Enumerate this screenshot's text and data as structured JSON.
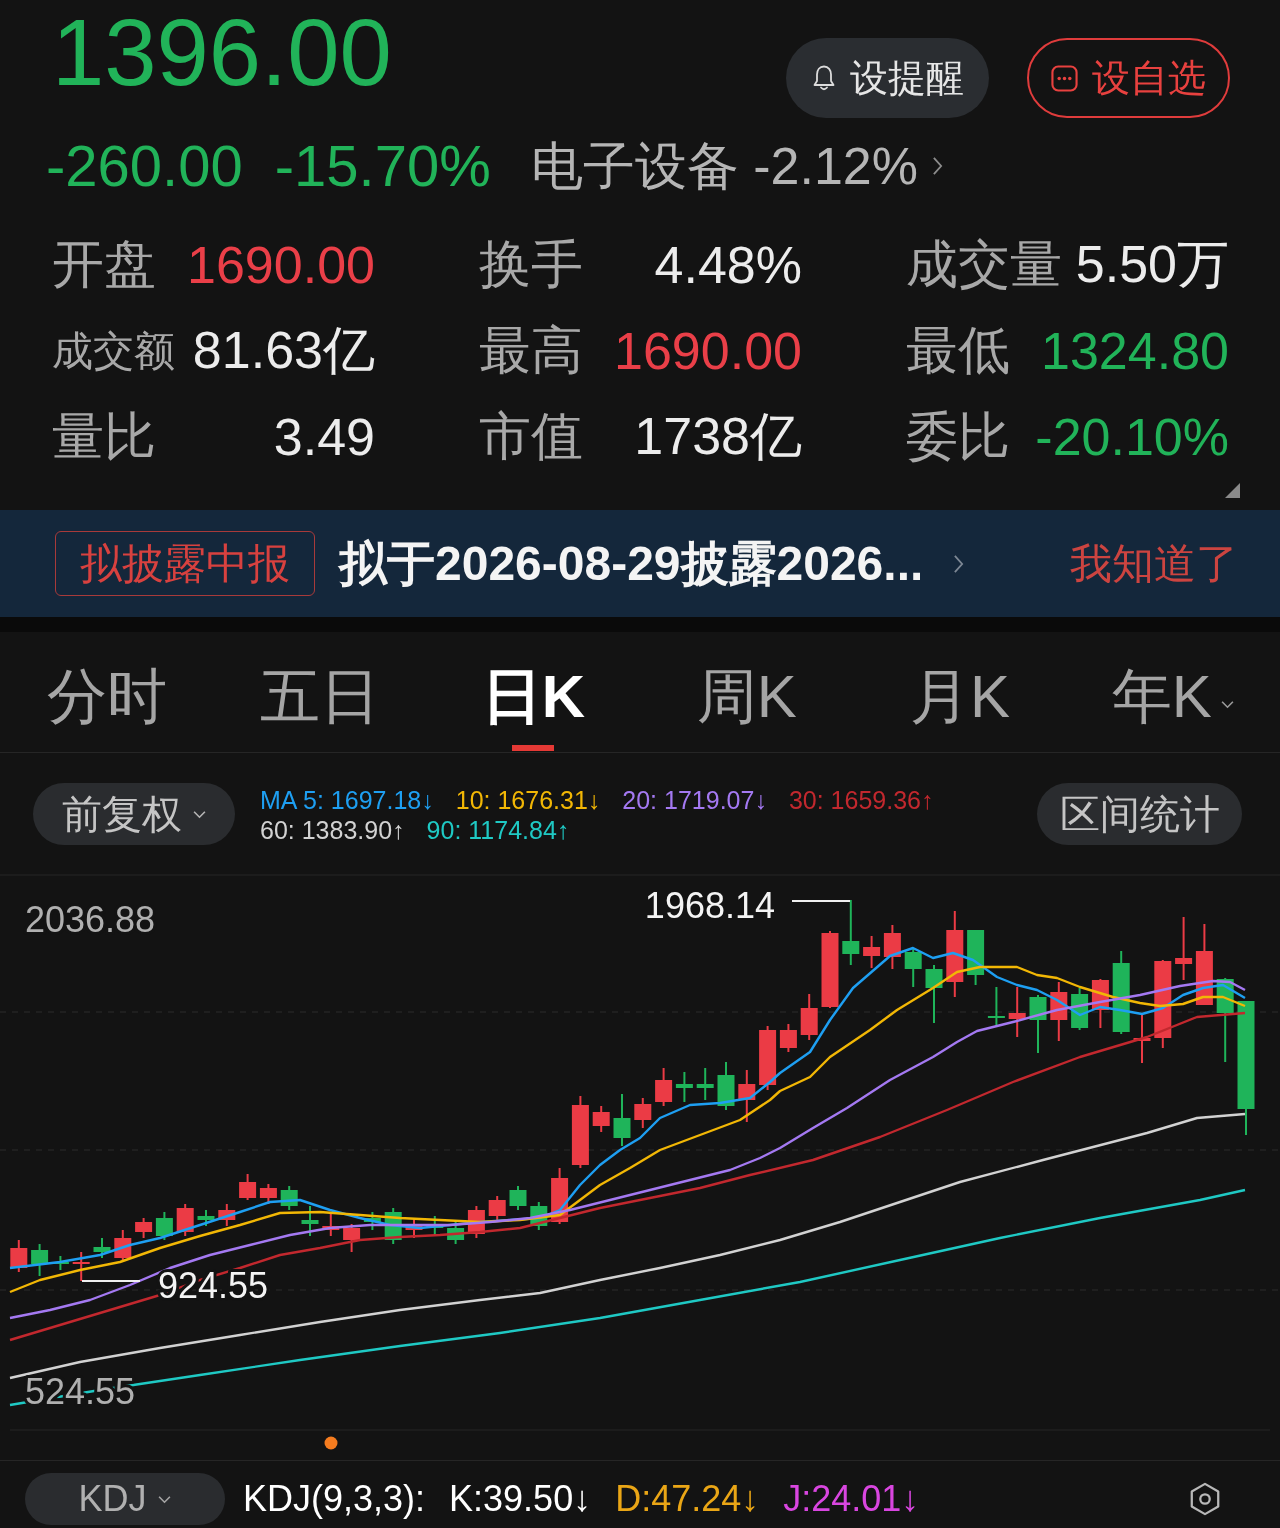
{
  "quote": {
    "price": "1396.00",
    "change": "-260.00",
    "change_percent": "-15.70%",
    "falling": true,
    "sector_link": "电子设备 -2.12%"
  },
  "actions": [
    {
      "kind": "alert",
      "label": "设提醒"
    },
    {
      "kind": "watchlist",
      "label": "设自选"
    }
  ],
  "stats": [
    {
      "label": "开盘",
      "value": "1690.00",
      "color": "#ea3f48"
    },
    {
      "label": "换手",
      "value": "4.48%",
      "color": "#ececec"
    },
    {
      "label": "成交量",
      "value": "5.50万",
      "color": "#ececec"
    },
    {
      "label": "成交额",
      "value": "81.63亿",
      "color": "#ececec"
    },
    {
      "label": "最高",
      "value": "1690.00",
      "color": "#ea3f48"
    },
    {
      "label": "最低",
      "value": "1324.80",
      "color": "#21b359"
    },
    {
      "label": "量比",
      "value": "3.49",
      "color": "#ececec"
    },
    {
      "label": "市值",
      "value": "1738亿",
      "color": "#ececec"
    },
    {
      "label": "委比",
      "value": "-20.10%",
      "color": "#21b359"
    }
  ],
  "notice": {
    "tag": "拟披露中报",
    "text": "拟于2026-08-29披露2026...",
    "dismiss": "我知道了"
  },
  "period_tabs": [
    {
      "label": "分时",
      "selected": false,
      "has_menu": false
    },
    {
      "label": "五日",
      "selected": false,
      "has_menu": false
    },
    {
      "label": "日K",
      "selected": true,
      "has_menu": false
    },
    {
      "label": "周K",
      "selected": false,
      "has_menu": false
    },
    {
      "label": "月K",
      "selected": false,
      "has_menu": false
    },
    {
      "label": "年K",
      "selected": false,
      "has_menu": true
    }
  ],
  "chart_toolbar": {
    "adjust_button": "前复权",
    "range_button": "区间统计",
    "ma_legend": [
      {
        "text": "MA 5: 1697.18↓",
        "color": "#1e9ff2"
      },
      {
        "text": "10: 1676.31↓",
        "color": "#f2b705"
      },
      {
        "text": "20: 1719.07↓",
        "color": "#a479f2"
      },
      {
        "text": "30: 1659.36↑",
        "color": "#c2282e"
      },
      {
        "text": "60: 1383.90↑",
        "color": "#d2d2d2"
      },
      {
        "text": "90: 1174.84↑",
        "color": "#1fc9c4"
      }
    ]
  },
  "chart": {
    "axis_labels": [
      "2036.88",
      "524.55"
    ],
    "high_label": "1968.14",
    "low_label": "924.55"
  },
  "indicator": {
    "selector": "KDJ",
    "title": "KDJ(9,3,3):",
    "values": [
      {
        "text": "K:39.50↓",
        "color": "#ffffff"
      },
      {
        "text": "D:47.24↓",
        "color": "#eaa616"
      },
      {
        "text": "J:24.01↓",
        "color": "#d946e0"
      }
    ]
  }
}
